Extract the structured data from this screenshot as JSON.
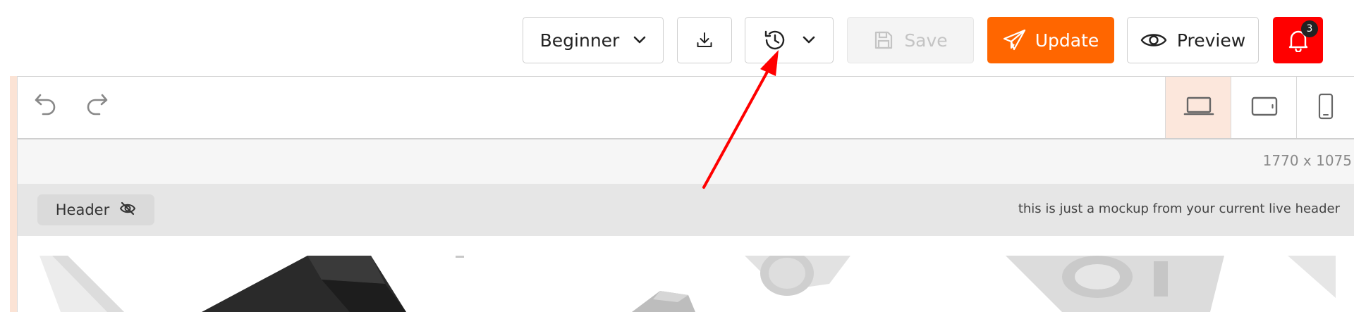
{
  "toolbar": {
    "level_select": {
      "value": "Beginner",
      "icon": "chevron-down-icon"
    },
    "download": {
      "icon": "download-icon"
    },
    "history": {
      "icon": "history-clock-icon",
      "dropdown_icon": "chevron-down-icon"
    },
    "save": {
      "label": "Save",
      "icon": "floppy-disk-icon",
      "disabled": true
    },
    "update": {
      "label": "Update",
      "icon": "paper-plane-icon",
      "color": "#ff6600"
    },
    "preview": {
      "label": "Preview",
      "icon": "eye-icon"
    },
    "notifications": {
      "count": "3",
      "icon": "bell-icon",
      "color": "#ff0000"
    }
  },
  "editor": {
    "undo_icon": "undo-icon",
    "redo_icon": "redo-icon",
    "devices": [
      {
        "name": "desktop",
        "icon": "laptop-icon",
        "active": true
      },
      {
        "name": "tablet",
        "icon": "tablet-icon",
        "active": false
      },
      {
        "name": "mobile",
        "icon": "phone-icon",
        "active": false
      }
    ],
    "dimensions": "1770 x 1075"
  },
  "header_section": {
    "label": "Header",
    "icon": "eye-slash-icon",
    "note": "this is just a mockup from your current live header"
  },
  "colors": {
    "accent": "#ff6600",
    "alert": "#ff0000",
    "active_device_bg": "#fce7dc",
    "annotation_arrow": "#ff0000"
  }
}
